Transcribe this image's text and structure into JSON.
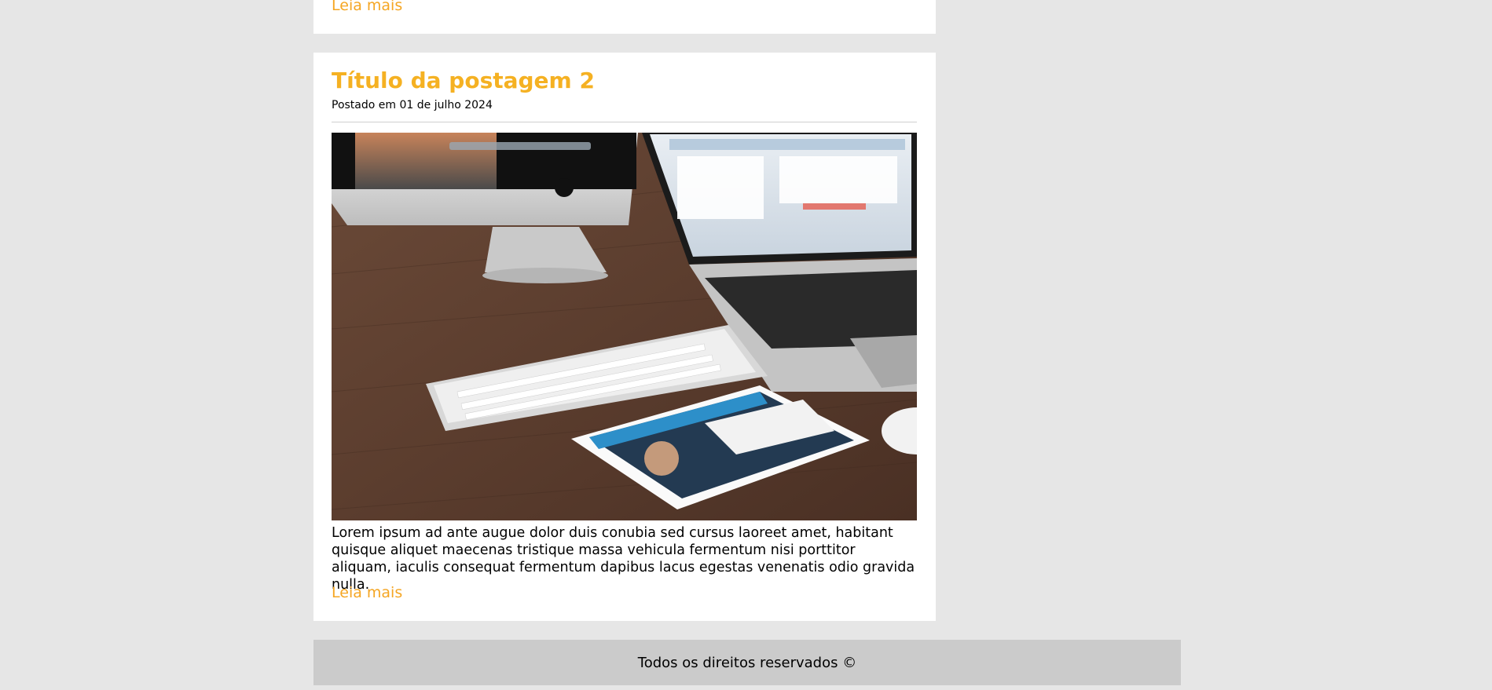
{
  "previous_post": {
    "read_more_label": "Leia mais"
  },
  "post": {
    "title": "Título da postagem 2",
    "date": "Postado em 01 de julho 2024",
    "image_description_icon": "desk-devices-photo",
    "body": "Lorem ipsum ad ante augue dolor duis conubia sed cursus laoreet amet, habitant quisque aliquet maecenas tristique massa vehicula fermentum nisi porttitor aliquam, iaculis consequat fermentum dapibus lacus egestas venenatis odio gravida nulla.",
    "read_more_label": "Leia mais"
  },
  "footer": {
    "text": "Todos os direitos reservados ©"
  },
  "colors": {
    "accent": "#f5a623",
    "title": "#f5b122",
    "page_background": "#e6e6e6",
    "card_background": "#ffffff",
    "footer_background": "#cbcbcb"
  }
}
